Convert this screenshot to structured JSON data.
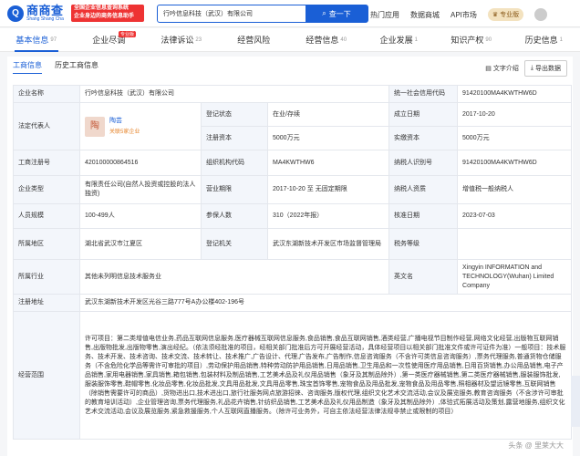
{
  "header": {
    "logo_text": "商商查",
    "logo_sub": "Shang Shang Cha",
    "promo_line1": "全国企业信息查询系统",
    "promo_line2": "企业身边的商务信息助手",
    "search_value": "行吟信息科技（武汉）有限公司",
    "search_button": "查一下",
    "nav": [
      "热门应用",
      "数据商城",
      "API市场"
    ],
    "vip_label": "专业版"
  },
  "tabs": [
    {
      "label": "基本信息",
      "count": "97",
      "active": true
    },
    {
      "label": "企业尽调",
      "count": "",
      "badge": "专业版"
    },
    {
      "label": "法律诉讼",
      "count": "23"
    },
    {
      "label": "经营风险",
      "count": ""
    },
    {
      "label": "经营信息",
      "count": "40"
    },
    {
      "label": "企业发展",
      "count": "1"
    },
    {
      "label": "知识产权",
      "count": "90"
    },
    {
      "label": "历史信息",
      "count": "1"
    }
  ],
  "subtabs": [
    "工商信息",
    "历史工商信息"
  ],
  "tools": {
    "text_mode": "文字介绍",
    "export": "导出数据"
  },
  "info": {
    "company_name_label": "企业名称",
    "company_name": "行吟信息科技（武汉）有限公司",
    "credit_code_label": "统一社会信用代码",
    "credit_code": "91420100MA4KWTHW6D",
    "legal_rep_label": "法定代表人",
    "legal_rep_avatar": "陶",
    "legal_rep_name": "陶芸",
    "legal_rep_related": "关联5家企业",
    "reg_status_label": "登记状态",
    "reg_status": "在业/存续",
    "founded_label": "成立日期",
    "founded": "2017-10-20",
    "reg_capital_label": "注册资本",
    "reg_capital": "5000万元",
    "paid_capital_label": "实缴资本",
    "paid_capital": "5000万元",
    "reg_no_label": "工商注册号",
    "reg_no": "420100000864516",
    "org_code_label": "组织机构代码",
    "org_code": "MA4KWTHW6",
    "taxpayer_id_label": "纳税人识别号",
    "taxpayer_id": "91420100MA4KWTHW6D",
    "company_type_label": "企业类型",
    "company_type": "有限责任公司(自然人投资或控股的法人独资)",
    "term_label": "营业期限",
    "term": "2017-10-20 至 无固定期限",
    "taxpayer_qual_label": "纳税人资质",
    "taxpayer_qual": "增值税一般纳税人",
    "staff_label": "人员规模",
    "staff": "100-499人",
    "insured_label": "参保人数",
    "insured": "310（2022年报）",
    "approval_label": "核准日期",
    "approval": "2023-07-03",
    "region_label": "所属地区",
    "region": "湖北省武汉市江夏区",
    "authority_label": "登记机关",
    "authority": "武汉东湖新技术开发区市场监督管理局",
    "tax_credit_label": "税务等级",
    "tax_credit": "",
    "industry_label": "所属行业",
    "industry": "其他未列明信息技术服务业",
    "english_label": "英文名",
    "english": "Xingyin INFORMATION and TECHNOLOGY(Wuhan) Limited Company",
    "address_label": "注册地址",
    "address": "武汉东湖新技术开发区光谷三路777号A办公楼402-196号",
    "scope_label": "经营范围",
    "scope": "许可项目：第二类增值电信业务,药品互联网信息服务,医疗器械互联网信息服务,食品销售,食品互联网销售,酒类经营,广播电视节目制作经营,网络文化经营,出版物互联网销售,出版物批发,出版物零售,演出经纪。（依法须经批准的项目，经相关部门批准后方可开展经营活动，具体经营项目以相关部门批准文件或许可证件为准）一般项目：技术服务、技术开发、技术咨询、技术交流、技术转让、技术推广,广告设计、代理,广告发布,广告制作,信息咨询服务（不含许可类信息咨询服务）,票务代理服务,普通货物仓储服务（不含危险化学品等需许可审批的项目）,劳动保护用品销售,特种劳动防护用品销售,日用品销售,卫生用品和一次性使用医疗用品销售,日用百货销售,办公用品销售,电子产品销售,家用电器销售,家具销售,箱包销售,包装材料及制品销售,工艺美术品及礼仪用品销售（象牙及其制品除外）,第一类医疗器械销售,第二类医疗器械销售,服装服饰批发,服装服饰零售,鞋帽零售,化妆品零售,化妆品批发,文具用品批发,文具用品零售,珠宝首饰零售,宠物食品及用品批发,宠物食品及用品零售,照相器材及望远镜零售,互联网销售（除销售需要许可的商品）,货物进出口,技术进出口,旅行社服务网点旅游招徕、咨询服务,版权代理,组织文化艺术交流活动,会议及展览服务,教育咨询服务（不含涉许可审批的教育培训活动）,企业管理咨询,票务代理服务,礼品花卉销售,针纺织品销售,工艺美术品及礼仪用品制造（象牙及其制品除外）,体验式拓展活动及策划,露营地服务,组织文化艺术交流活动,会议及展览服务,紧急救援服务,个人互联网直播服务。（除许可业务外，可自主依法经营法律法规非禁止或限制的项目）"
  },
  "watermark": "头条 @ 里莱大大"
}
